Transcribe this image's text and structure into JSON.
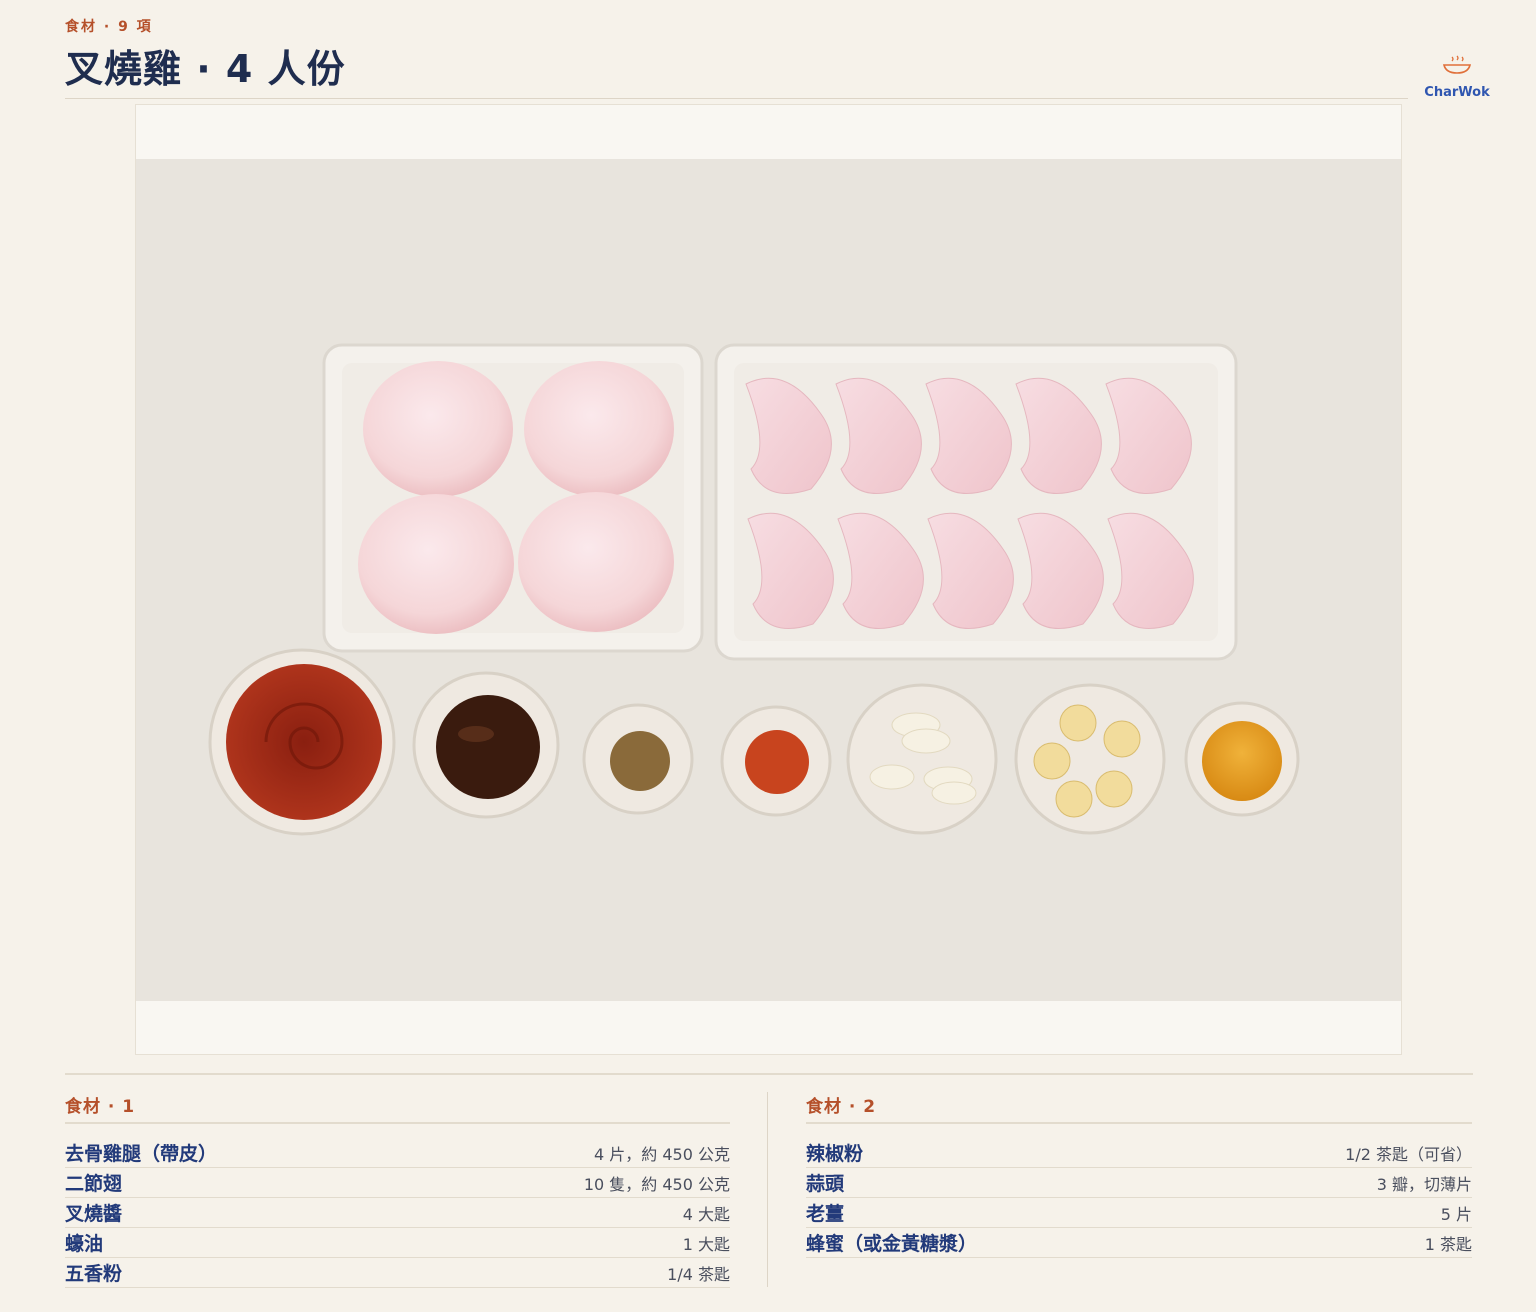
{
  "header": {
    "kicker": "食材 · 9 項",
    "title": "叉燒雞 · 4 人份"
  },
  "logo": {
    "text": "CharWok",
    "icon": "steaming-bowl-icon"
  },
  "colors": {
    "accent": "#b5502a",
    "navy": "#1f2d4f",
    "brand": "#2f56b0",
    "background": "#f6f2ea"
  },
  "ingredients": [
    {
      "heading": "食材 · 1",
      "items": [
        {
          "name": "去骨雞腿（帶皮）",
          "qty": "4 片，約 450 公克"
        },
        {
          "name": "二節翅",
          "qty": "10 隻，約 450 公克"
        },
        {
          "name": "叉燒醬",
          "qty": "4 大匙"
        },
        {
          "name": "蠔油",
          "qty": "1 大匙"
        },
        {
          "name": "五香粉",
          "qty": "1/4 茶匙"
        }
      ]
    },
    {
      "heading": "食材 · 2",
      "items": [
        {
          "name": "辣椒粉",
          "qty": "1/2 茶匙（可省）"
        },
        {
          "name": "蒜頭",
          "qty": "3 瓣，切薄片"
        },
        {
          "name": "老薑",
          "qty": "5 片"
        },
        {
          "name": "蜂蜜（或金黃糖漿）",
          "qty": "1 茶匙"
        }
      ]
    }
  ]
}
